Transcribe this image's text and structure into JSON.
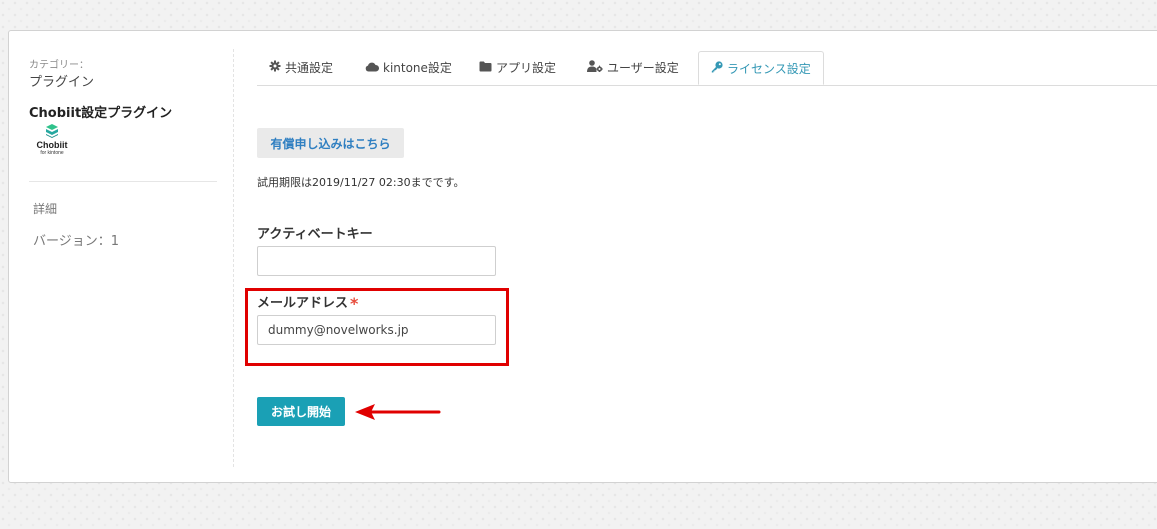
{
  "sidebar": {
    "category_label": "カテゴリー：",
    "category_value": "プラグイン",
    "plugin_name": "Chobiit設定プラグイン",
    "logo": {
      "name": "Chobiit",
      "tagline": "for kintone",
      "icon": "chobiit-logo-icon"
    },
    "detail_link": "詳細",
    "version_label": "バージョン：",
    "version_value": "1"
  },
  "tabs": [
    {
      "label": "共通設定",
      "icon": "gear-icon",
      "active": false
    },
    {
      "label": "kintone設定",
      "icon": "cloud-icon",
      "active": false
    },
    {
      "label": "アプリ設定",
      "icon": "folder-icon",
      "active": false
    },
    {
      "label": "ユーザー設定",
      "icon": "user-gear-icon",
      "active": false
    },
    {
      "label": "ライセンス設定",
      "icon": "key-icon",
      "active": true
    }
  ],
  "license": {
    "buy_button_label": "有償申し込みはこちら",
    "trial_text": "試用期限は2019/11/27 02:30までです。",
    "activate_key_label": "アクティベートキー",
    "activate_key_value": "",
    "email_label": "メールアドレス",
    "email_required_mark": "*",
    "email_value": "dummy@novelworks.jp",
    "start_button_label": "お試し開始"
  },
  "colors": {
    "accent": "#3498b5",
    "button_primary": "#1aa0b5",
    "annotation": "#e00000",
    "required": "#e74c3c"
  }
}
